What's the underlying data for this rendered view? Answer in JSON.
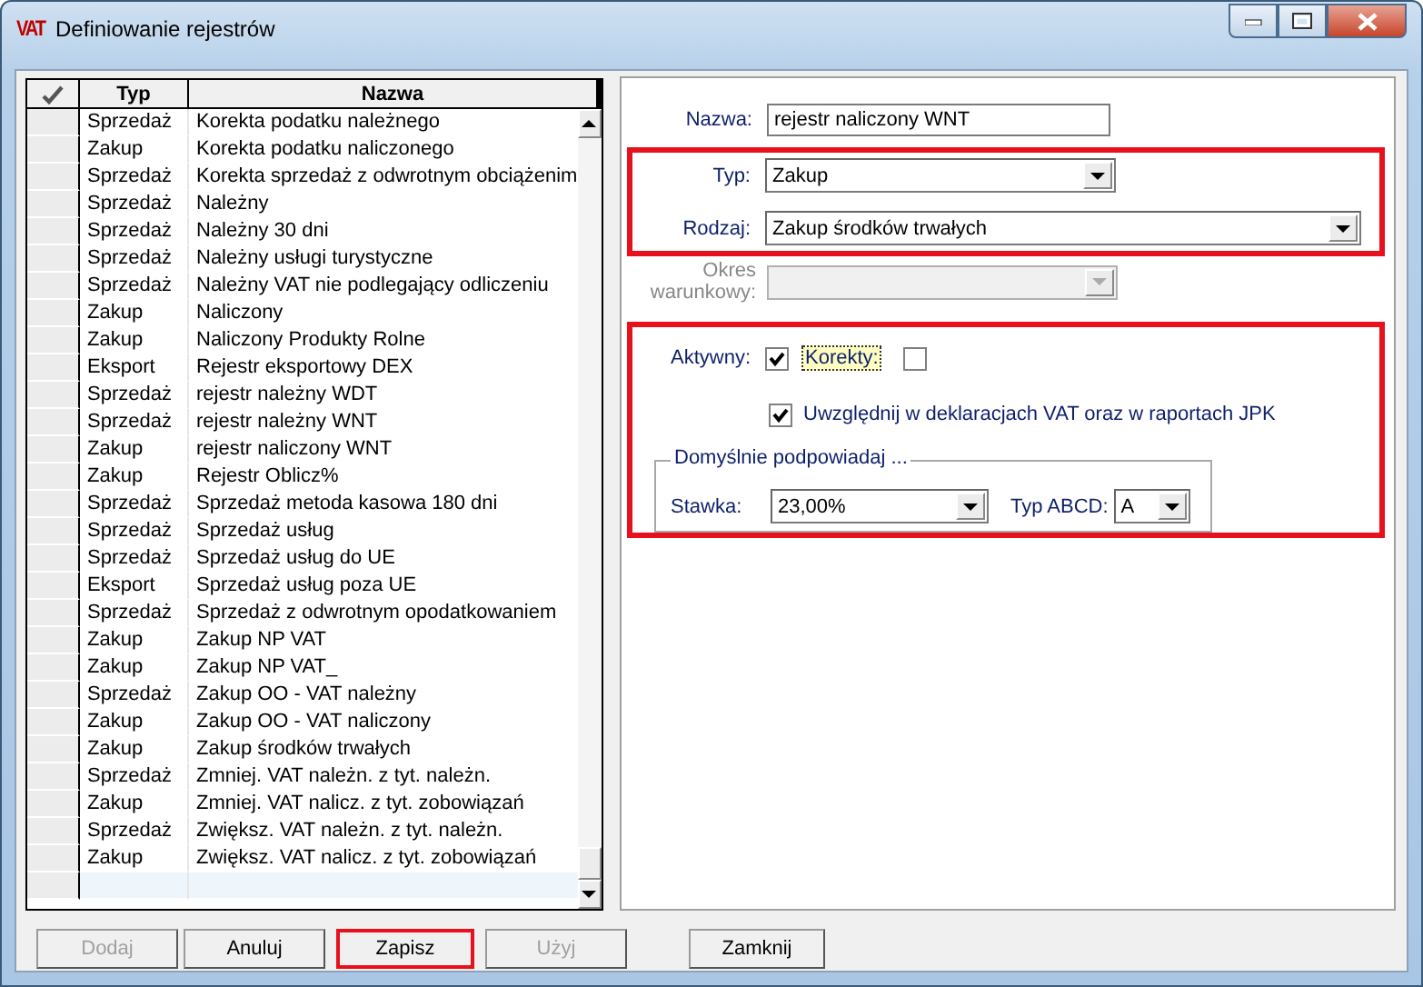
{
  "window": {
    "icon_text": "VAT",
    "title": "Definiowanie rejestrów"
  },
  "grid": {
    "columns": [
      "Typ",
      "Nazwa"
    ],
    "rows": [
      {
        "typ": "Sprzedaż",
        "nazwa": "Korekta podatku należnego"
      },
      {
        "typ": "Zakup",
        "nazwa": "Korekta podatku naliczonego"
      },
      {
        "typ": "Sprzedaż",
        "nazwa": "Korekta sprzedaż z odwrotnym obciążenim"
      },
      {
        "typ": "Sprzedaż",
        "nazwa": "Należny"
      },
      {
        "typ": "Sprzedaż",
        "nazwa": "Należny 30 dni"
      },
      {
        "typ": "Sprzedaż",
        "nazwa": "Należny usługi turystyczne"
      },
      {
        "typ": "Sprzedaż",
        "nazwa": "Należny VAT nie podlegający odliczeniu"
      },
      {
        "typ": "Zakup",
        "nazwa": "Naliczony"
      },
      {
        "typ": "Zakup",
        "nazwa": "Naliczony Produkty Rolne"
      },
      {
        "typ": "Eksport",
        "nazwa": "Rejestr eksportowy DEX"
      },
      {
        "typ": "Sprzedaż",
        "nazwa": "rejestr należny WDT"
      },
      {
        "typ": "Sprzedaż",
        "nazwa": "rejestr należny WNT"
      },
      {
        "typ": "Zakup",
        "nazwa": "rejestr naliczony WNT"
      },
      {
        "typ": "Zakup",
        "nazwa": "Rejestr Oblicz%"
      },
      {
        "typ": "Sprzedaż",
        "nazwa": "Sprzedaż metoda kasowa 180 dni"
      },
      {
        "typ": "Sprzedaż",
        "nazwa": "Sprzedaż usług"
      },
      {
        "typ": "Sprzedaż",
        "nazwa": "Sprzedaż usług do UE"
      },
      {
        "typ": "Eksport",
        "nazwa": "Sprzedaż usług poza UE"
      },
      {
        "typ": "Sprzedaż",
        "nazwa": "Sprzedaż z odwrotnym opodatkowaniem"
      },
      {
        "typ": "Zakup",
        "nazwa": "Zakup NP VAT"
      },
      {
        "typ": "Zakup",
        "nazwa": "Zakup NP VAT_"
      },
      {
        "typ": "Sprzedaż",
        "nazwa": "Zakup OO - VAT należny"
      },
      {
        "typ": "Zakup",
        "nazwa": "Zakup OO - VAT naliczony"
      },
      {
        "typ": "Zakup",
        "nazwa": "Zakup środków trwałych"
      },
      {
        "typ": "Sprzedaż",
        "nazwa": "Zmniej. VAT należn. z tyt. należn."
      },
      {
        "typ": "Zakup",
        "nazwa": "Zmniej. VAT nalicz. z tyt. zobowiązań"
      },
      {
        "typ": "Sprzedaż",
        "nazwa": "Zwiększ. VAT należn. z tyt. należn."
      },
      {
        "typ": "Zakup",
        "nazwa": "Zwiększ. VAT nalicz. z tyt. zobowiązań"
      }
    ]
  },
  "form": {
    "nazwa": {
      "label": "Nazwa:",
      "value": "rejestr naliczony WNT"
    },
    "section_1": {
      "highlighted": true,
      "typ": {
        "label": "Typ:",
        "value": "Zakup"
      },
      "rodzaj": {
        "label": "Rodzaj:",
        "value": "Zakup środków trwałych"
      }
    },
    "okres": {
      "label": "Okres warunkowy:",
      "disabled": true
    },
    "section_2": {
      "highlighted": true,
      "aktywny": {
        "label": "Aktywny:",
        "checked": true
      },
      "korekty": {
        "label": "Korekty:",
        "checked": false,
        "focused": true
      },
      "uwzglednij": {
        "label": "Uwzględnij w deklaracjach VAT oraz w raportach JPK",
        "checked": true
      },
      "group": {
        "title": "Domyślnie podpowiadaj ...",
        "stawka": {
          "label": "Stawka:",
          "value": "23,00%"
        },
        "typ_abcd": {
          "label": "Typ ABCD:",
          "value": "A"
        }
      }
    }
  },
  "buttons": [
    {
      "label": "Dodaj",
      "disabled": true,
      "highlighted": false
    },
    {
      "label": "Anuluj",
      "disabled": false,
      "highlighted": false
    },
    {
      "label": "Zapisz",
      "disabled": false,
      "highlighted": true
    },
    {
      "label": "Użyj",
      "disabled": true,
      "highlighted": false
    }
  ],
  "close_button": {
    "label": "Zamknij"
  }
}
